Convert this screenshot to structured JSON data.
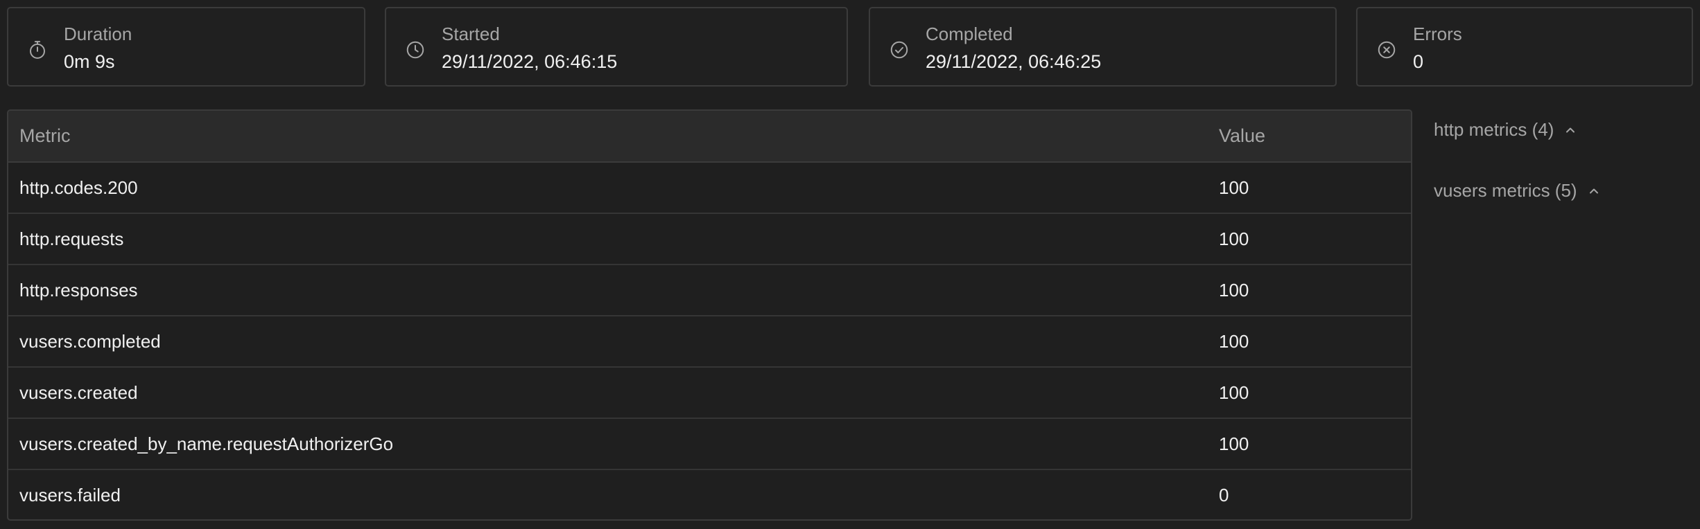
{
  "summary": {
    "duration": {
      "label": "Duration",
      "value": "0m 9s",
      "icon": "stopwatch-icon"
    },
    "started": {
      "label": "Started",
      "value": "29/11/2022, 06:46:15",
      "icon": "clock-icon"
    },
    "completed": {
      "label": "Completed",
      "value": "29/11/2022, 06:46:25",
      "icon": "check-circle-icon"
    },
    "errors": {
      "label": "Errors",
      "value": "0",
      "icon": "x-circle-icon"
    }
  },
  "table": {
    "headers": {
      "metric": "Metric",
      "value": "Value"
    },
    "rows": [
      {
        "metric": "http.codes.200",
        "value": "100"
      },
      {
        "metric": "http.requests",
        "value": "100"
      },
      {
        "metric": "http.responses",
        "value": "100"
      },
      {
        "metric": "vusers.completed",
        "value": "100"
      },
      {
        "metric": "vusers.created",
        "value": "100"
      },
      {
        "metric": "vusers.created_by_name.requestAuthorizerGo",
        "value": "100"
      },
      {
        "metric": "vusers.failed",
        "value": "0"
      }
    ]
  },
  "sidebar": {
    "groups": [
      {
        "label": "http metrics (4)",
        "icon": "chevron-up-icon"
      },
      {
        "label": "vusers metrics (5)",
        "icon": "chevron-up-icon"
      }
    ]
  },
  "colors": {
    "background": "#1f1f1f",
    "border": "#3b3b3b",
    "muted_text": "#a6a6a6",
    "text": "#f0f0f0"
  }
}
